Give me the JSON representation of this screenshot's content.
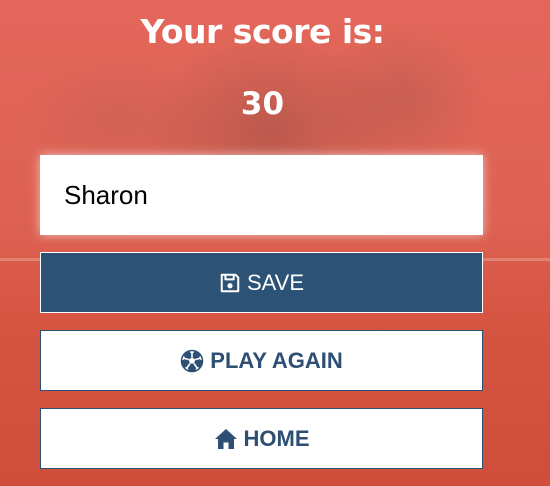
{
  "title": "Your score is:",
  "score": "30",
  "name_input": {
    "value": "Sharon"
  },
  "buttons": {
    "save": {
      "label": "SAVE",
      "icon": "floppy-disk-icon"
    },
    "play_again": {
      "label": "PLAY AGAIN",
      "icon": "soccer-ball-icon"
    },
    "home": {
      "label": "HOME",
      "icon": "home-icon"
    }
  },
  "colors": {
    "background": "#dc5f4c",
    "primary": "#2c5275",
    "text_light": "#ffffff"
  }
}
